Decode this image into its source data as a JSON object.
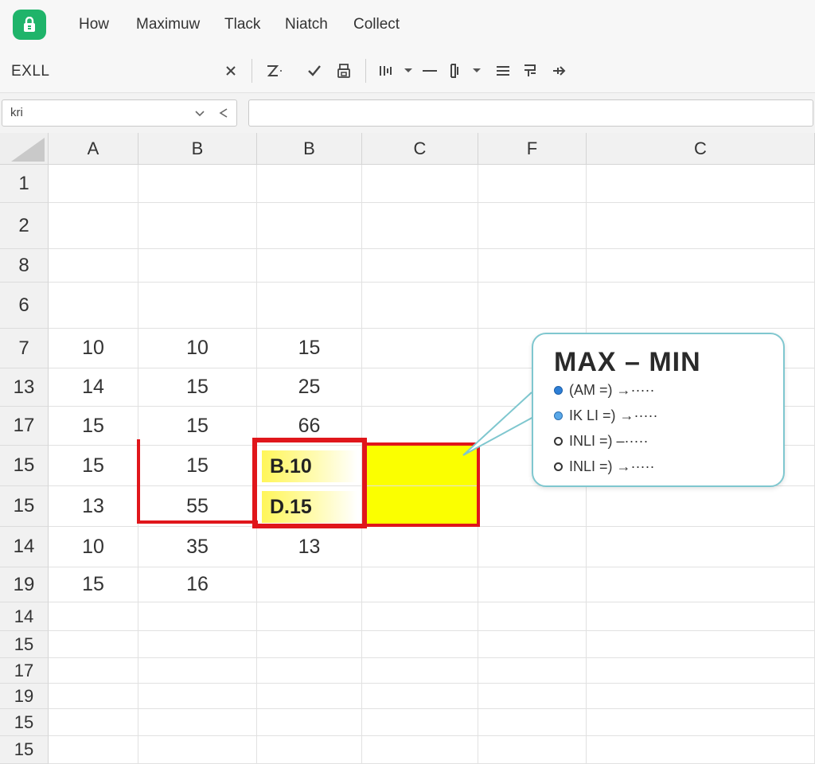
{
  "menu": {
    "items": [
      "How",
      "Maximuw",
      "Tlack",
      "Niatch",
      "Collect"
    ]
  },
  "toolbar": {
    "app_name": "EXLL",
    "icons": [
      "close-icon",
      "text-format-icon",
      "check-icon",
      "print-icon",
      "columns-icon",
      "minus-icon",
      "bracket-icon",
      "lines-icon",
      "chart-icon",
      "arrow-icon"
    ]
  },
  "formula_bar": {
    "name_box_value": "kri",
    "formula_value": ""
  },
  "grid": {
    "column_headers": [
      "A",
      "B",
      "B",
      "C",
      "F",
      "C"
    ],
    "row_headers": [
      "1",
      "2",
      "8",
      "6",
      "7",
      "13",
      "17",
      "15",
      "15",
      "14",
      "19",
      "14",
      "15",
      "17",
      "19",
      "15",
      "15"
    ],
    "rows": [
      [
        "",
        "",
        "",
        "",
        "",
        ""
      ],
      [
        "",
        "",
        "",
        "",
        "",
        ""
      ],
      [
        "",
        "",
        "",
        "",
        "",
        ""
      ],
      [
        "",
        "",
        "",
        "",
        "",
        ""
      ],
      [
        "10",
        "10",
        "15",
        "",
        "",
        ""
      ],
      [
        "14",
        "15",
        "25",
        "",
        "",
        ""
      ],
      [
        "15",
        "15",
        "66",
        "",
        "",
        ""
      ],
      [
        "15",
        "15",
        "",
        "",
        "",
        ""
      ],
      [
        "13",
        "55",
        "",
        "",
        "",
        ""
      ],
      [
        "10",
        "35",
        "13",
        "",
        "",
        ""
      ],
      [
        "15",
        "16",
        "",
        "",
        "",
        ""
      ],
      [
        "",
        "",
        "",
        "",
        "",
        ""
      ],
      [
        "",
        "",
        "",
        "",
        "",
        ""
      ],
      [
        "",
        "",
        "",
        "",
        "",
        ""
      ],
      [
        "",
        "",
        "",
        "",
        "",
        ""
      ],
      [
        "",
        "",
        "",
        "",
        "",
        ""
      ],
      [
        "",
        "",
        "",
        "",
        "",
        ""
      ]
    ],
    "highlight_labels": [
      "B.10",
      "D.15"
    ]
  },
  "callout": {
    "title": "MAX – MIN",
    "lines": [
      {
        "text": "(AM =) →·····",
        "marker": "filled"
      },
      {
        "text": "IK LI =) →·····",
        "marker": "filled-light"
      },
      {
        "text": "INLI =) –·····",
        "marker": "hollow"
      },
      {
        "text": "INLI =) →·····",
        "marker": "hollow"
      }
    ]
  },
  "colors": {
    "accent_green": "#1fb46a",
    "highlight_red": "#e0161b",
    "highlight_yellow": "#fbff00",
    "callout_border": "#7fc7cf"
  }
}
